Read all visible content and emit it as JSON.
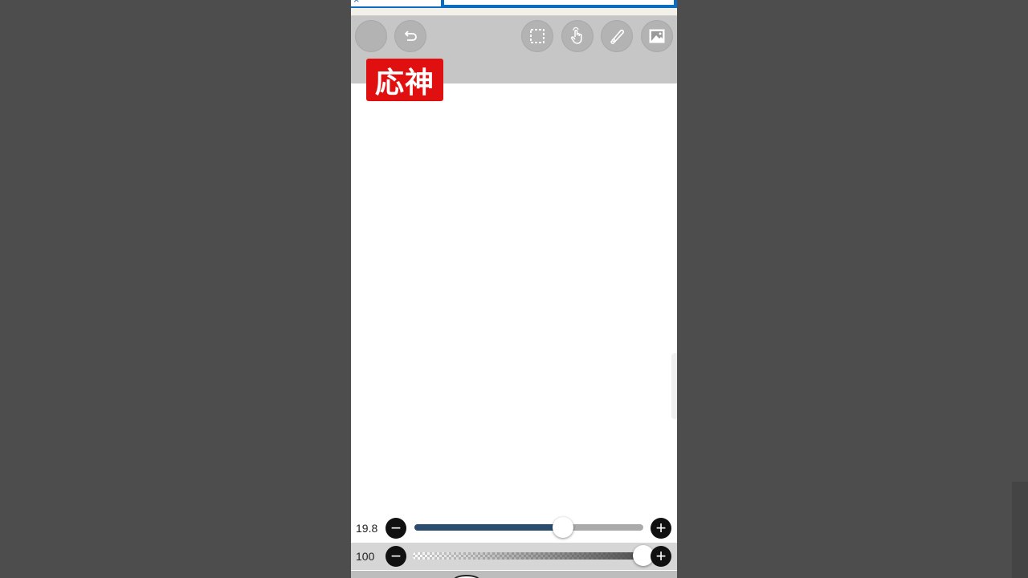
{
  "ad": {
    "close_icon": "×"
  },
  "toolbar": {
    "buttons": [
      {
        "name": "undo-button",
        "icon": "undo-icon"
      },
      {
        "name": "redo-button",
        "icon": "redo-icon"
      },
      {
        "name": "selection-button",
        "icon": "selection-icon"
      },
      {
        "name": "hand-button",
        "icon": "hand-icon"
      },
      {
        "name": "ruler-button",
        "icon": "ruler-icon"
      },
      {
        "name": "material-button",
        "icon": "image-icon"
      }
    ]
  },
  "overlay_label": "応神",
  "brush": {
    "size_value": "19.8",
    "size_level": 0.65,
    "opacity_value": "100",
    "opacity_level": 1.0,
    "minus": "−",
    "plus": "+"
  },
  "colors": {
    "label_bg": "#e01010",
    "slider_fill": "#2a4c6e",
    "toolbar_bg": "#c6c6c6"
  }
}
